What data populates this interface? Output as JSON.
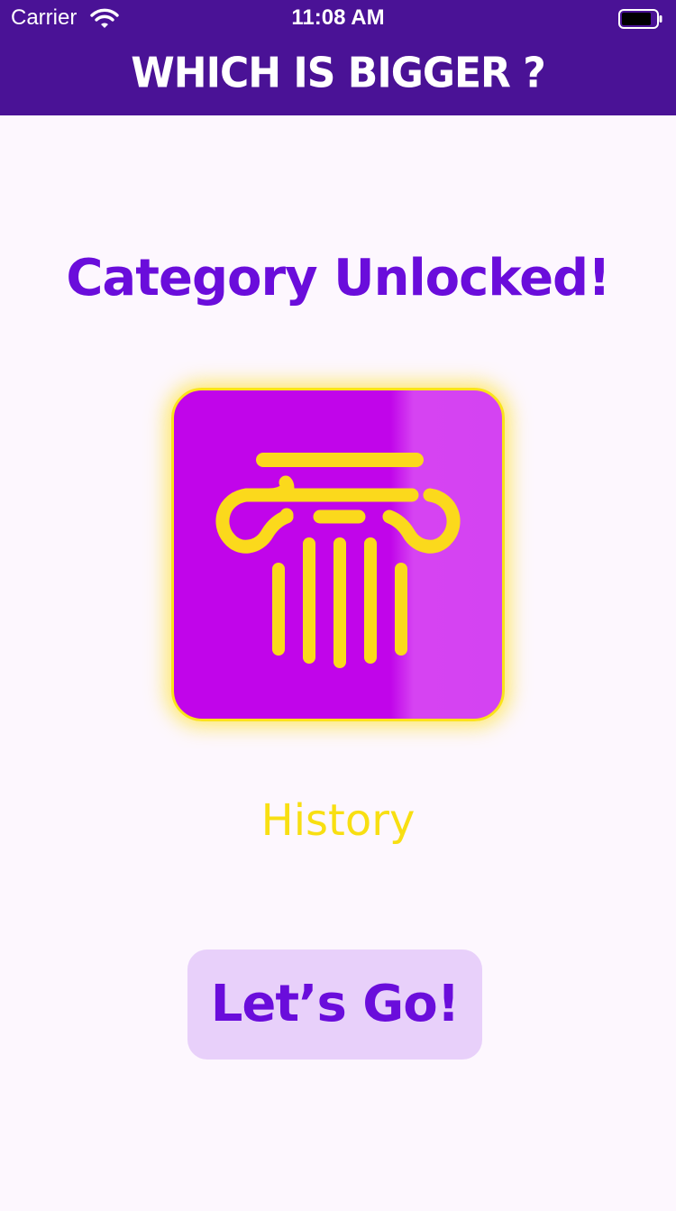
{
  "status_bar": {
    "carrier": "Carrier",
    "time": "11:08 AM",
    "wifi_icon": "wifi-icon",
    "battery_icon": "battery-icon"
  },
  "header": {
    "title": "WHICH IS BIGGER ?"
  },
  "main": {
    "heading": "Category Unlocked!",
    "category": {
      "name": "History",
      "icon": "column-icon"
    },
    "go_button_label": "Let’s Go!"
  },
  "colors": {
    "header_bg": "#4a1296",
    "page_bg": "#fdf7fe",
    "heading_purple": "#6a0ddb",
    "card_purple": "#c105ea",
    "accent_yellow": "#fbe31a",
    "button_bg": "#e8d0fa"
  }
}
